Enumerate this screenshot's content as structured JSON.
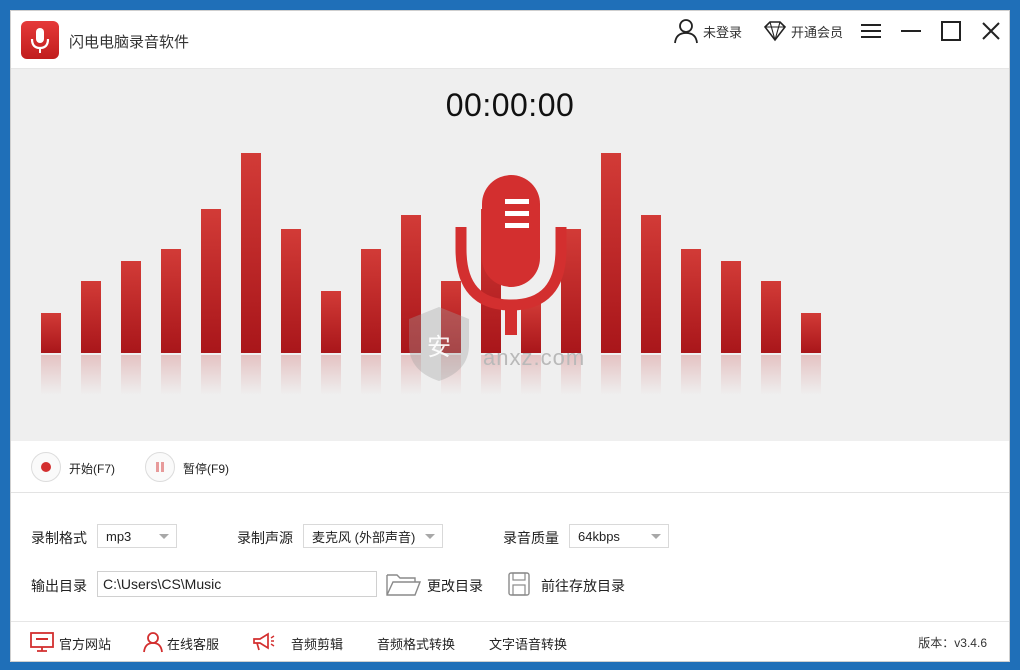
{
  "app": {
    "title": "闪电电脑录音软件"
  },
  "titlebar": {
    "login_label": "未登录",
    "vip_label": "开通会员"
  },
  "timer": "00:00:00",
  "visualizer": {
    "levels": [
      0.2,
      0.36,
      0.46,
      0.52,
      0.72,
      1.0,
      0.62,
      0.31,
      0.52,
      0.69,
      0.36,
      0.72,
      0.26,
      0.62,
      1.0,
      0.69,
      0.52,
      0.46,
      0.36,
      0.2
    ],
    "watermark": "anxz.com",
    "accent": "#d32f2f"
  },
  "controls": {
    "start_label": "开始(F7)",
    "pause_label": "暂停(F9)"
  },
  "settings": {
    "format_label": "录制格式",
    "format_value": "mp3",
    "source_label": "录制声源",
    "source_value": "麦克风 (外部声音)",
    "quality_label": "录音质量",
    "quality_value": "64kbps",
    "output_label": "输出目录",
    "output_path": "C:\\Users\\CS\\Music",
    "change_dir_label": "更改目录",
    "goto_dir_label": "前往存放目录"
  },
  "footer": {
    "website_label": "官方网站",
    "service_label": "在线客服",
    "edit_label": "音频剪辑",
    "convert_label": "音频格式转换",
    "tts_label": "文字语音转换",
    "version": "版本：v3.4.6"
  }
}
